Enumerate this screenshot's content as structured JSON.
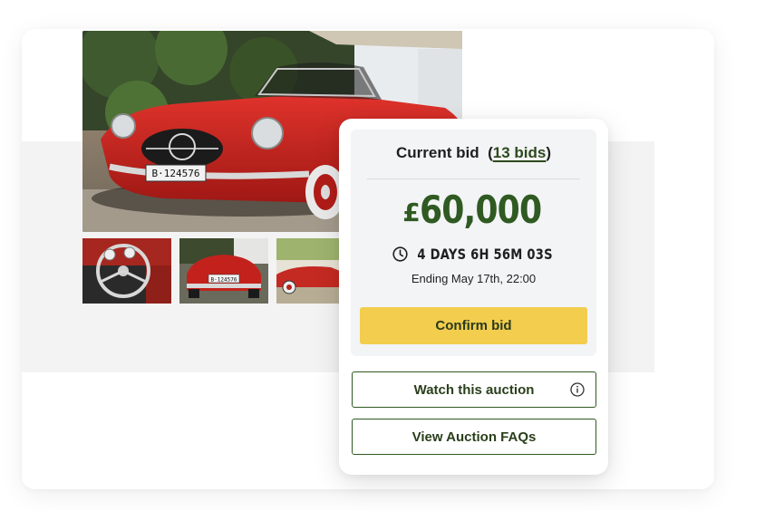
{
  "images": {
    "main": {
      "alt": "main-car-photo"
    },
    "thumbnails": [
      "steering-wheel-photo",
      "car-rear-photo",
      "car-side-photo"
    ]
  },
  "car": {
    "plate_main": "B·124576",
    "plate_rear": "B·124576",
    "body_color": "#c8221f"
  },
  "bid": {
    "header_label": "Current bid",
    "bids_open": "(",
    "bids_count_label": "13 bids",
    "bids_close": ")",
    "currency": "£",
    "amount": "60,000",
    "time_remaining": "4 DAYS 6H 56M 03S",
    "ending": "Ending May 17th, 22:00",
    "confirm_label": "Confirm bid"
  },
  "actions": {
    "watch_label": "Watch this auction",
    "faq_label": "View Auction FAQs"
  },
  "colors": {
    "accent_green": "#2f5a22",
    "confirm_yellow": "#f2cd4e",
    "panel_gray": "#f3f4f6"
  },
  "icons": {
    "timer": "clock-icon",
    "info": "info-icon"
  }
}
